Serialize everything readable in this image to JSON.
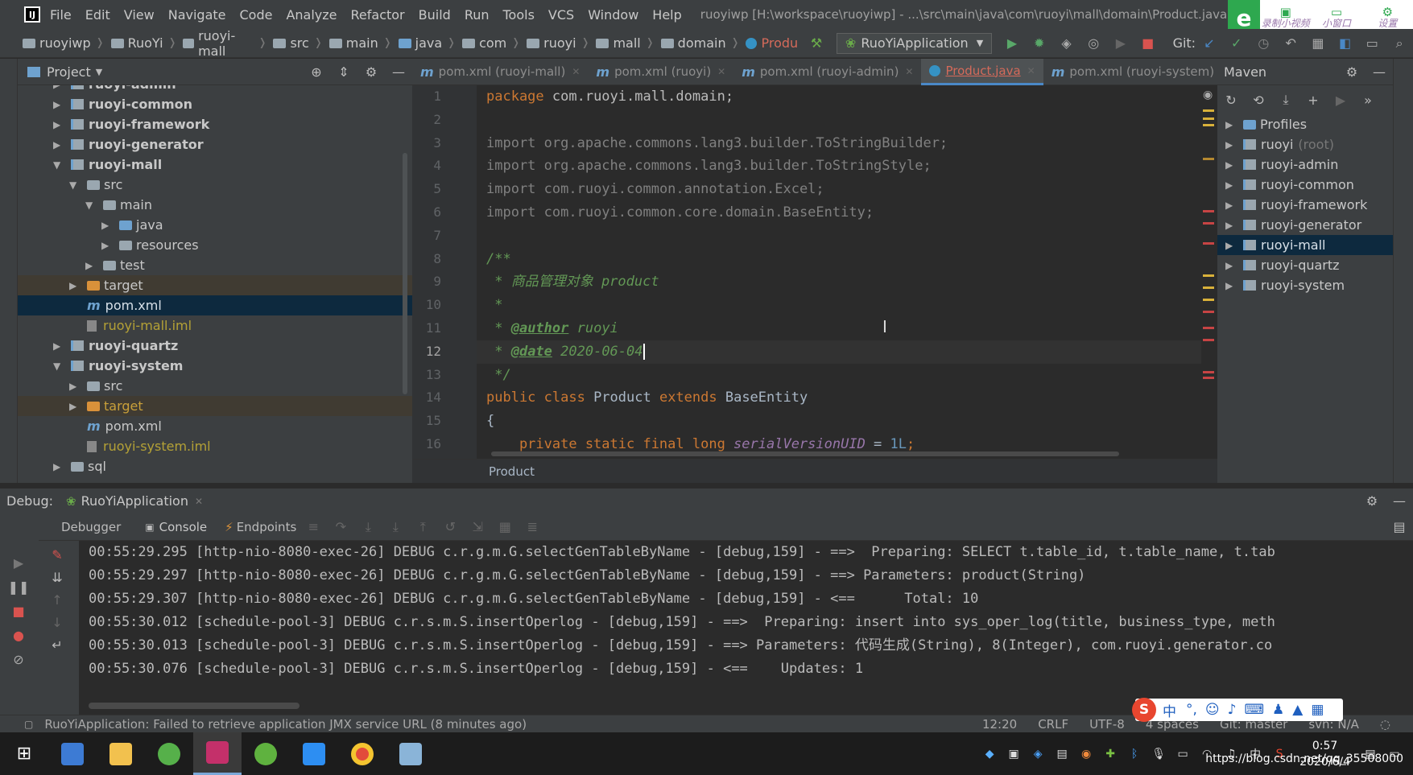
{
  "menubar": {
    "items": [
      "File",
      "Edit",
      "View",
      "Navigate",
      "Code",
      "Analyze",
      "Refactor",
      "Build",
      "Run",
      "Tools",
      "VCS",
      "Window",
      "Help"
    ],
    "window_title": "ruoyiwp [H:\\workspace\\ruoyiwp] - ...\\src\\main\\java\\com\\ruoyi\\mall\\domain\\Product.java [ruoyi-m"
  },
  "recorder": {
    "items": [
      {
        "label": "录制小视频",
        "icon": "video-icon"
      },
      {
        "label": "小窗口",
        "icon": "window-icon"
      },
      {
        "label": "设置",
        "icon": "gear-icon"
      }
    ]
  },
  "breadcrumb": [
    "ruoyiwp",
    "RuoYi",
    "ruoyi-mall",
    "src",
    "main",
    "java",
    "com",
    "ruoyi",
    "mall",
    "domain",
    "Produ"
  ],
  "run_config": "RuoYiApplication",
  "git_label": "Git:",
  "project_panel": {
    "title": "Project",
    "tree": [
      {
        "label": "ruoyi-admin",
        "depth": 0,
        "arrow": "right",
        "icon": "module",
        "style": "bold"
      },
      {
        "label": "ruoyi-common",
        "depth": 0,
        "arrow": "right",
        "icon": "module",
        "style": "bold"
      },
      {
        "label": "ruoyi-framework",
        "depth": 0,
        "arrow": "right",
        "icon": "module",
        "style": "bold"
      },
      {
        "label": "ruoyi-generator",
        "depth": 0,
        "arrow": "right",
        "icon": "module",
        "style": "bold"
      },
      {
        "label": "ruoyi-mall",
        "depth": 0,
        "arrow": "down",
        "icon": "module",
        "style": "bold"
      },
      {
        "label": "src",
        "depth": 1,
        "arrow": "down",
        "icon": "folder",
        "style": ""
      },
      {
        "label": "main",
        "depth": 2,
        "arrow": "down",
        "icon": "folder",
        "style": ""
      },
      {
        "label": "java",
        "depth": 3,
        "arrow": "right",
        "icon": "folder-blue",
        "style": ""
      },
      {
        "label": "resources",
        "depth": 3,
        "arrow": "right",
        "icon": "folder",
        "style": ""
      },
      {
        "label": "test",
        "depth": 2,
        "arrow": "right",
        "icon": "folder",
        "style": ""
      },
      {
        "label": "target",
        "depth": 1,
        "arrow": "right",
        "icon": "folder-orange",
        "style": "target"
      },
      {
        "label": "pom.xml",
        "depth": 1,
        "arrow": "",
        "icon": "maven",
        "style": "selected"
      },
      {
        "label": "ruoyi-mall.iml",
        "depth": 1,
        "arrow": "",
        "icon": "file",
        "style": "iml"
      },
      {
        "label": "ruoyi-quartz",
        "depth": 0,
        "arrow": "right",
        "icon": "module",
        "style": "bold"
      },
      {
        "label": "ruoyi-system",
        "depth": 0,
        "arrow": "down",
        "icon": "module",
        "style": "bold"
      },
      {
        "label": "src",
        "depth": 1,
        "arrow": "right",
        "icon": "folder",
        "style": ""
      },
      {
        "label": "target",
        "depth": 1,
        "arrow": "right",
        "icon": "folder-orange",
        "style": "target-ora"
      },
      {
        "label": "pom.xml",
        "depth": 1,
        "arrow": "",
        "icon": "maven",
        "style": ""
      },
      {
        "label": "ruoyi-system.iml",
        "depth": 1,
        "arrow": "",
        "icon": "file",
        "style": "iml"
      },
      {
        "label": "sql",
        "depth": 0,
        "arrow": "right",
        "icon": "folder",
        "style": ""
      }
    ]
  },
  "editor_tabs": [
    {
      "label": "pom.xml (ruoyi-mall)",
      "icon": "maven",
      "active": false
    },
    {
      "label": "pom.xml (ruoyi)",
      "icon": "maven",
      "active": false
    },
    {
      "label": "pom.xml (ruoyi-admin)",
      "icon": "maven",
      "active": false
    },
    {
      "label": "Product.java",
      "icon": "class",
      "active": true
    },
    {
      "label": "pom.xml (ruoyi-system)",
      "icon": "maven",
      "active": false
    }
  ],
  "code": {
    "line_numbers": [
      "1",
      "2",
      "3",
      "4",
      "5",
      "6",
      "7",
      "8",
      "9",
      "10",
      "11",
      "12",
      "13",
      "14",
      "15",
      "16"
    ],
    "current_line": 12,
    "lines": [
      "package com.ruoyi.mall.domain;",
      "",
      "import org.apache.commons.lang3.builder.ToStringBuilder;",
      "import org.apache.commons.lang3.builder.ToStringStyle;",
      "import com.ruoyi.common.annotation.Excel;",
      "import com.ruoyi.common.core.domain.BaseEntity;",
      "",
      "/**",
      " * 商品管理对象 product",
      " *",
      " * @author ruoyi",
      " * @date 2020-06-04",
      " */",
      "public class Product extends BaseEntity",
      "{",
      "    private static final long serialVersionUID = 1L;"
    ],
    "breadcrumb": "Product"
  },
  "maven_panel": {
    "title": "Maven",
    "items": [
      {
        "label": "Profiles",
        "suffix": "",
        "icon": "profiles",
        "selected": false
      },
      {
        "label": "ruoyi",
        "suffix": "(root)",
        "icon": "module",
        "selected": false
      },
      {
        "label": "ruoyi-admin",
        "suffix": "",
        "icon": "module",
        "selected": false
      },
      {
        "label": "ruoyi-common",
        "suffix": "",
        "icon": "module",
        "selected": false
      },
      {
        "label": "ruoyi-framework",
        "suffix": "",
        "icon": "module",
        "selected": false
      },
      {
        "label": "ruoyi-generator",
        "suffix": "",
        "icon": "module",
        "selected": false
      },
      {
        "label": "ruoyi-mall",
        "suffix": "",
        "icon": "module",
        "selected": true
      },
      {
        "label": "ruoyi-quartz",
        "suffix": "",
        "icon": "module",
        "selected": false
      },
      {
        "label": "ruoyi-system",
        "suffix": "",
        "icon": "module",
        "selected": false
      }
    ]
  },
  "debug": {
    "label": "Debug:",
    "session": "RuoYiApplication",
    "tabs": [
      "Debugger",
      "Console",
      "Endpoints"
    ],
    "console_lines": [
      "00:55:29.295 [http-nio-8080-exec-26] DEBUG c.r.g.m.G.selectGenTableByName - [debug,159] - ==>  Preparing: SELECT t.table_id, t.table_name, t.tab",
      "00:55:29.297 [http-nio-8080-exec-26] DEBUG c.r.g.m.G.selectGenTableByName - [debug,159] - ==> Parameters: product(String)",
      "00:55:29.307 [http-nio-8080-exec-26] DEBUG c.r.g.m.G.selectGenTableByName - [debug,159] - <==      Total: 10",
      "00:55:30.012 [schedule-pool-3] DEBUG c.r.s.m.S.insertOperlog - [debug,159] - ==>  Preparing: insert into sys_oper_log(title, business_type, meth",
      "00:55:30.013 [schedule-pool-3] DEBUG c.r.s.m.S.insertOperlog - [debug,159] - ==> Parameters: 代码生成(String), 8(Integer), com.ruoyi.generator.co",
      "00:55:30.076 [schedule-pool-3] DEBUG c.r.s.m.S.insertOperlog - [debug,159] - <==    Updates: 1"
    ]
  },
  "status": {
    "message": "RuoYiApplication: Failed to retrieve application JMX service URL (8 minutes ago)",
    "position": "12:20",
    "line_sep": "CRLF",
    "encoding": "UTF-8",
    "indent": "4 spaces",
    "git": "Git: master",
    "svn": "svn: N/A"
  },
  "ime": {
    "brand": "S",
    "mode": "中"
  },
  "taskbar": {
    "clock_time": "0:57",
    "clock_date": "2020/6/4",
    "tray_lang": "中",
    "watermark": "https://blog.csdn.net/qq_35508000"
  }
}
